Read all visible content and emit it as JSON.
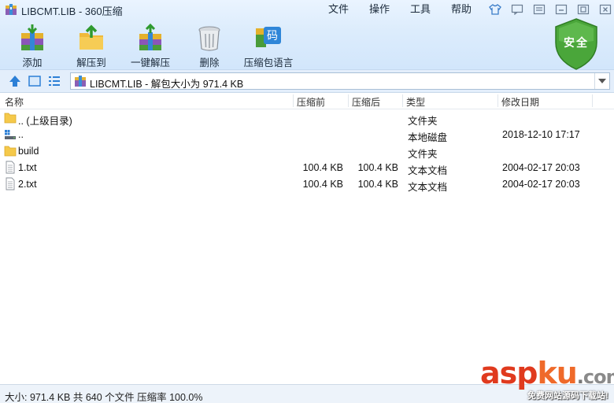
{
  "window": {
    "title": "LIBCMT.LIB - 360压缩"
  },
  "menu": [
    "文件",
    "操作",
    "工具",
    "帮助"
  ],
  "toolbar": [
    {
      "label": "添加",
      "icon": "add-archive-icon"
    },
    {
      "label": "解压到",
      "icon": "extract-to-icon"
    },
    {
      "label": "一键解压",
      "icon": "one-click-extract-icon"
    },
    {
      "label": "删除",
      "icon": "delete-trash-icon"
    },
    {
      "label": "压缩包语言",
      "icon": "archive-language-icon",
      "badge": "码"
    }
  ],
  "security_badge": "安全",
  "address": {
    "text": "LIBCMT.LIB - 解包大小为 971.4 KB"
  },
  "columns": {
    "name": "名称",
    "packed": "压缩前",
    "unpacked": "压缩后",
    "type": "类型",
    "modified": "修改日期"
  },
  "files": [
    {
      "name": ".. (上级目录)",
      "packed": "",
      "unpacked": "",
      "type": "文件夹",
      "modified": "",
      "icon": "folder-icon"
    },
    {
      "name": "..",
      "packed": "",
      "unpacked": "",
      "type": "本地磁盘",
      "modified": "2018-12-10 17:17",
      "icon": "local-disk-icon"
    },
    {
      "name": "build",
      "packed": "",
      "unpacked": "",
      "type": "文件夹",
      "modified": "",
      "icon": "folder-icon"
    },
    {
      "name": "1.txt",
      "packed": "100.4 KB",
      "unpacked": "100.4 KB",
      "type": "文本文档",
      "modified": "2004-02-17 20:03",
      "icon": "text-file-icon"
    },
    {
      "name": "2.txt",
      "packed": "100.4 KB",
      "unpacked": "100.4 KB",
      "type": "文本文档",
      "modified": "2004-02-17 20:03",
      "icon": "text-file-icon"
    }
  ],
  "status": {
    "text": "大小: 971.4 KB 共 640 个文件 压缩率 100.0%"
  },
  "watermark": {
    "asp": "asp",
    "ku": "ku",
    "dot": ".",
    "com": "com",
    "sub": "免费网站源码下载站!"
  },
  "colors": {
    "accent": "#2c7fd6",
    "shield": "#4aa63a",
    "watermark": "#e03a1e"
  }
}
